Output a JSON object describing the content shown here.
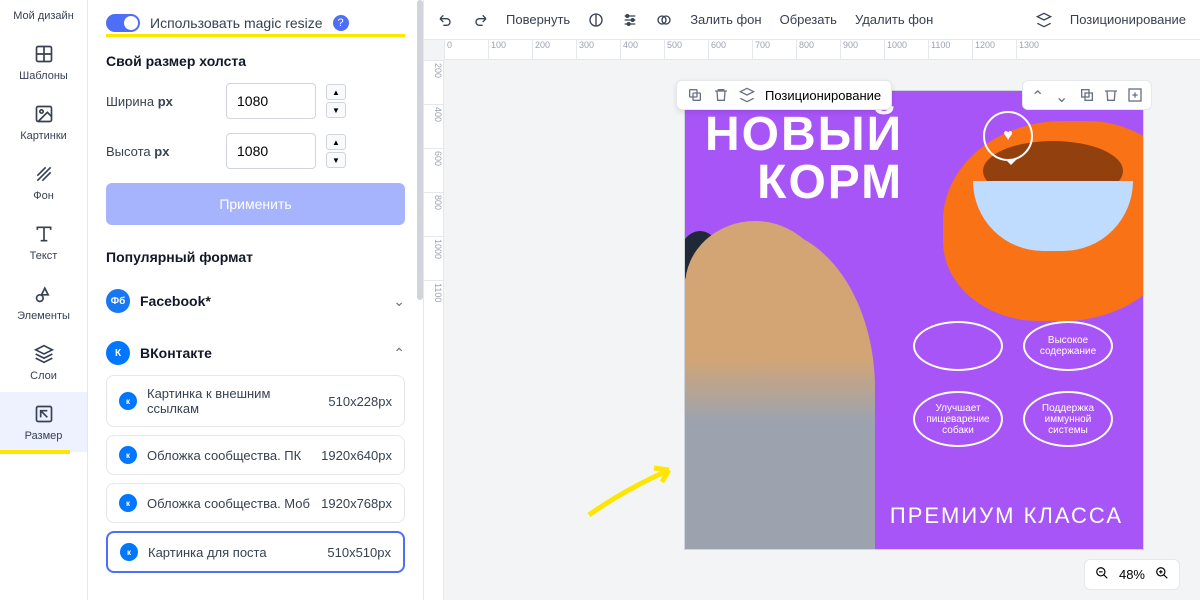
{
  "sidebar": {
    "items": [
      {
        "label": "Мой дизайн"
      },
      {
        "label": "Шаблоны"
      },
      {
        "label": "Картинки"
      },
      {
        "label": "Фон"
      },
      {
        "label": "Текст"
      },
      {
        "label": "Элементы"
      },
      {
        "label": "Слои"
      },
      {
        "label": "Размер"
      }
    ]
  },
  "panel": {
    "magic_resize_label": "Использовать magic resize",
    "custom_size_title": "Свой размер холста",
    "width_label": "Ширина",
    "height_label": "Высота",
    "unit": "px",
    "width_value": "1080",
    "height_value": "1080",
    "apply_label": "Применить",
    "popular_format_title": "Популярный формат",
    "facebook_label": "Facebook*",
    "vk_label": "ВКонтакте",
    "vk_formats": [
      {
        "label": "Картинка к внешним ссылкам",
        "size": "510x228px"
      },
      {
        "label": "Обложка сообщества. ПК",
        "size": "1920x640px"
      },
      {
        "label": "Обложка сообщества. Моб",
        "size": "1920x768px"
      },
      {
        "label": "Картинка для поста",
        "size": "510x510px"
      }
    ]
  },
  "toolbar": {
    "rotate": "Повернуть",
    "fill": "Залить фон",
    "crop": "Обрезать",
    "remove_bg": "Удалить фон",
    "position": "Позиционирование"
  },
  "float": {
    "position": "Позиционирование"
  },
  "canvas": {
    "headline1": "НОВЫЙ",
    "headline2": "КОРМ",
    "bubbles": [
      {
        "text": ""
      },
      {
        "text": "Высокое содержание"
      },
      {
        "text": "Улучшает пищеварение собаки"
      },
      {
        "text": "Поддержка иммунной системы"
      }
    ],
    "premium": "ПРЕМИУМ КЛАССА"
  },
  "zoom": {
    "value": "48%"
  },
  "ruler_h": [
    "0",
    "100",
    "200",
    "300",
    "400",
    "500",
    "600",
    "700",
    "800",
    "900",
    "1000",
    "1100",
    "1200",
    "1300"
  ],
  "ruler_v": [
    "200",
    "400",
    "600",
    "800",
    "1000",
    "1100"
  ]
}
